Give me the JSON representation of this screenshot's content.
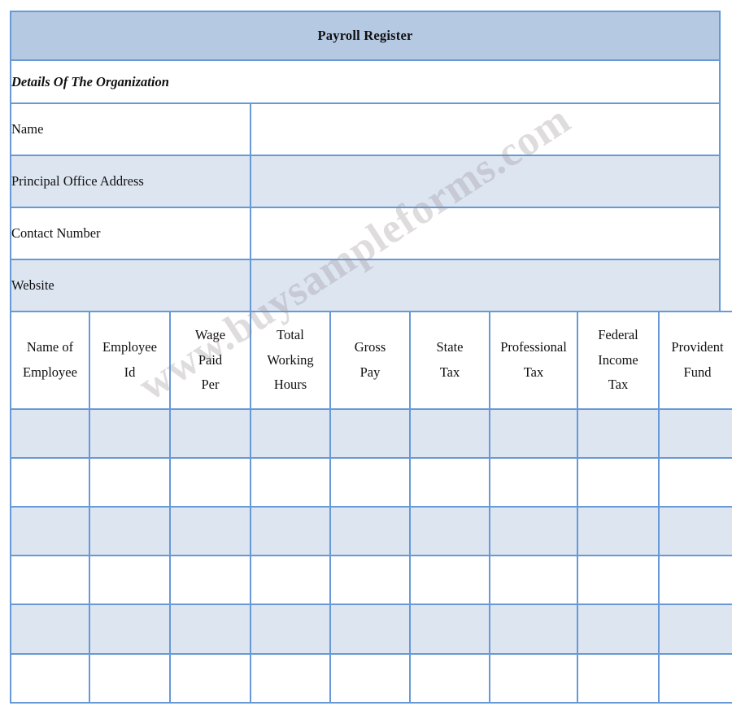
{
  "document": {
    "title": "Payroll Register",
    "section_heading": "Details Of The Organization",
    "watermark": "www.buysampleforms.com"
  },
  "colors": {
    "title_bar_bg": "#b6c9e3",
    "row_tint_bg": "#dde5f1",
    "row_plain_bg": "#ffffff",
    "border": "#6699d6",
    "text": "#101010",
    "watermark": "#968c91"
  },
  "organization_fields": [
    {
      "label": "Name",
      "value": ""
    },
    {
      "label": "Principal Office Address",
      "value": ""
    },
    {
      "label": "Contact Number",
      "value": ""
    },
    {
      "label": "Website",
      "value": ""
    }
  ],
  "employee_table": {
    "columns": [
      {
        "lines": [
          "Name of",
          "Employee"
        ]
      },
      {
        "lines": [
          "Employee",
          "Id"
        ]
      },
      {
        "lines": [
          "Wage",
          "Paid",
          "Per"
        ]
      },
      {
        "lines": [
          "Total",
          "Working",
          "Hours"
        ]
      },
      {
        "lines": [
          "Gross",
          "Pay"
        ]
      },
      {
        "lines": [
          "State",
          "Tax"
        ]
      },
      {
        "lines": [
          "Professional",
          "Tax"
        ]
      },
      {
        "lines": [
          "Federal",
          "Income",
          "Tax"
        ]
      },
      {
        "lines": [
          "Provident",
          "Fund"
        ]
      }
    ],
    "rows": [
      [
        "",
        "",
        "",
        "",
        "",
        "",
        "",
        "",
        ""
      ],
      [
        "",
        "",
        "",
        "",
        "",
        "",
        "",
        "",
        ""
      ],
      [
        "",
        "",
        "",
        "",
        "",
        "",
        "",
        "",
        ""
      ],
      [
        "",
        "",
        "",
        "",
        "",
        "",
        "",
        "",
        ""
      ],
      [
        "",
        "",
        "",
        "",
        "",
        "",
        "",
        "",
        ""
      ],
      [
        "",
        "",
        "",
        "",
        "",
        "",
        "",
        "",
        ""
      ]
    ]
  }
}
